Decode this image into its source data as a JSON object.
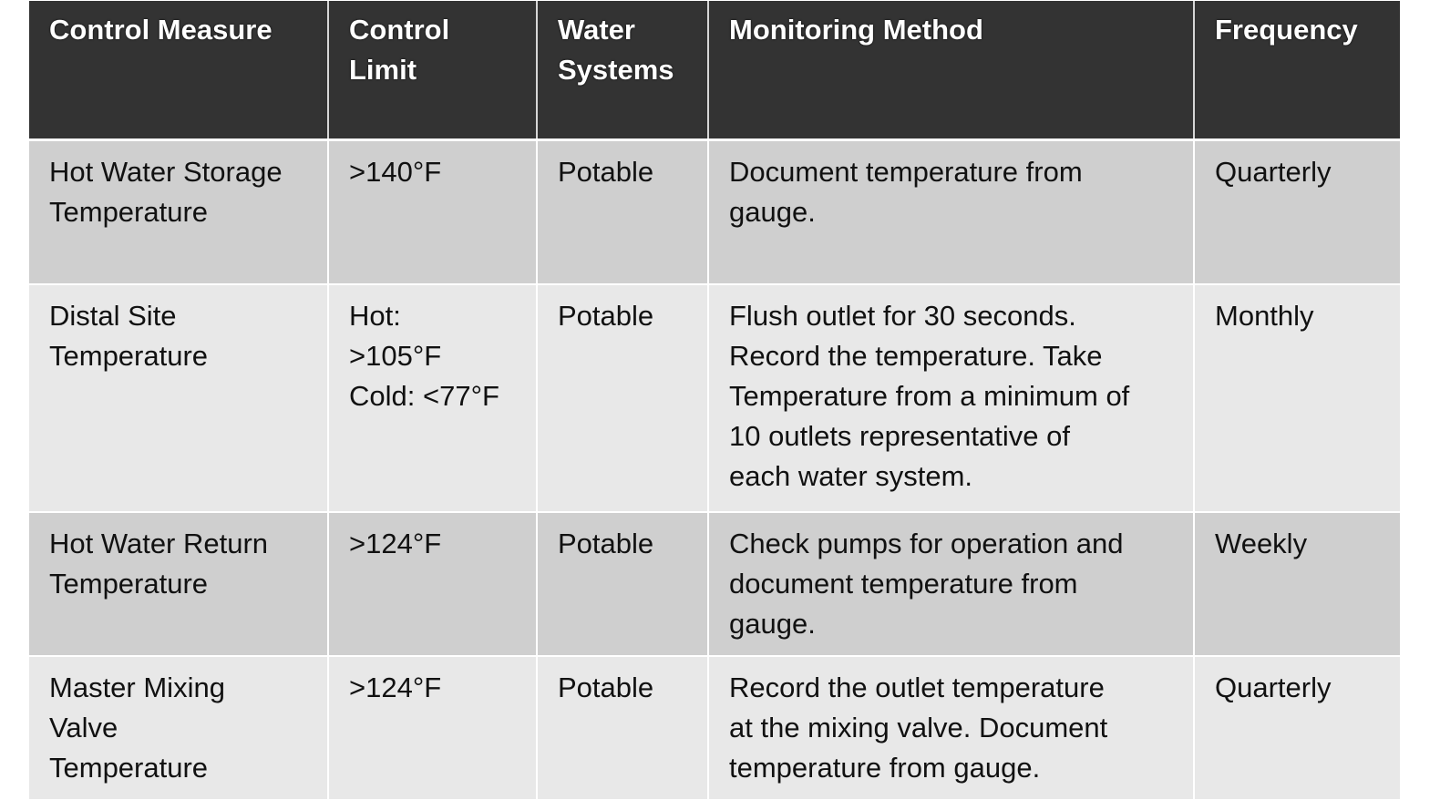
{
  "table": {
    "headers": [
      [
        "Control Measure"
      ],
      [
        "Control",
        "Limit"
      ],
      [
        "Water",
        "Systems"
      ],
      [
        "Monitoring Method"
      ],
      [
        "Frequency"
      ]
    ],
    "rows": [
      {
        "control_measure": [
          "Hot Water Storage",
          "Temperature"
        ],
        "control_limit": [
          ">140°F"
        ],
        "water_systems": [
          "Potable"
        ],
        "monitoring_method": [
          "Document temperature from",
          "gauge."
        ],
        "frequency": [
          "Quarterly"
        ]
      },
      {
        "control_measure": [
          "Distal Site",
          "Temperature"
        ],
        "control_limit": [
          "Hot:",
          ">105°F",
          "Cold: <77°F"
        ],
        "water_systems": [
          "Potable"
        ],
        "monitoring_method": [
          "Flush outlet for 30 seconds.",
          "Record the temperature. Take",
          "Temperature from a minimum of",
          "10 outlets representative of",
          "each water system."
        ],
        "frequency": [
          "Monthly"
        ]
      },
      {
        "control_measure": [
          "Hot Water Return",
          "Temperature"
        ],
        "control_limit": [
          ">124°F"
        ],
        "water_systems": [
          "Potable"
        ],
        "monitoring_method": [
          "Check pumps for operation and",
          "document temperature from",
          "gauge."
        ],
        "frequency": [
          "Weekly"
        ]
      },
      {
        "control_measure": [
          "Master Mixing",
          "Valve",
          "Temperature"
        ],
        "control_limit": [
          ">124°F"
        ],
        "water_systems": [
          "Potable"
        ],
        "monitoring_method": [
          "Record the outlet temperature",
          "at the mixing valve. Document",
          "temperature from gauge."
        ],
        "frequency": [
          "Quarterly"
        ]
      }
    ]
  },
  "colors": {
    "header_bg": "#333333",
    "header_text": "#ffffff",
    "row_odd_bg": "#cfcfcf",
    "row_even_bg": "#e8e8e8",
    "body_text": "#111111"
  }
}
